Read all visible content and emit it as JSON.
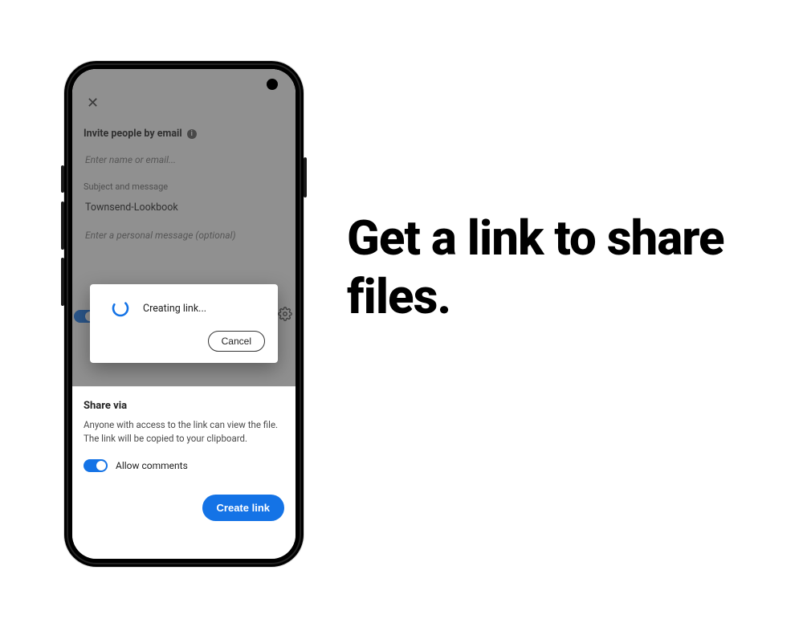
{
  "marketing": {
    "headline": "Get a link to share files."
  },
  "app": {
    "invite_label": "Invite people by email",
    "email_placeholder": "Enter name or email...",
    "subject_section": "Subject and message",
    "subject_value": "Townsend-Lookbook",
    "message_placeholder": "Enter a personal message (optional)"
  },
  "dialog": {
    "status": "Creating link...",
    "cancel": "Cancel"
  },
  "sheet": {
    "title": "Share via",
    "desc": "Anyone with access to the link can view the file. The link will be copied to your clipboard.",
    "allow_comments": "Allow comments",
    "create_link": "Create link"
  },
  "colors": {
    "accent": "#1473e6"
  }
}
